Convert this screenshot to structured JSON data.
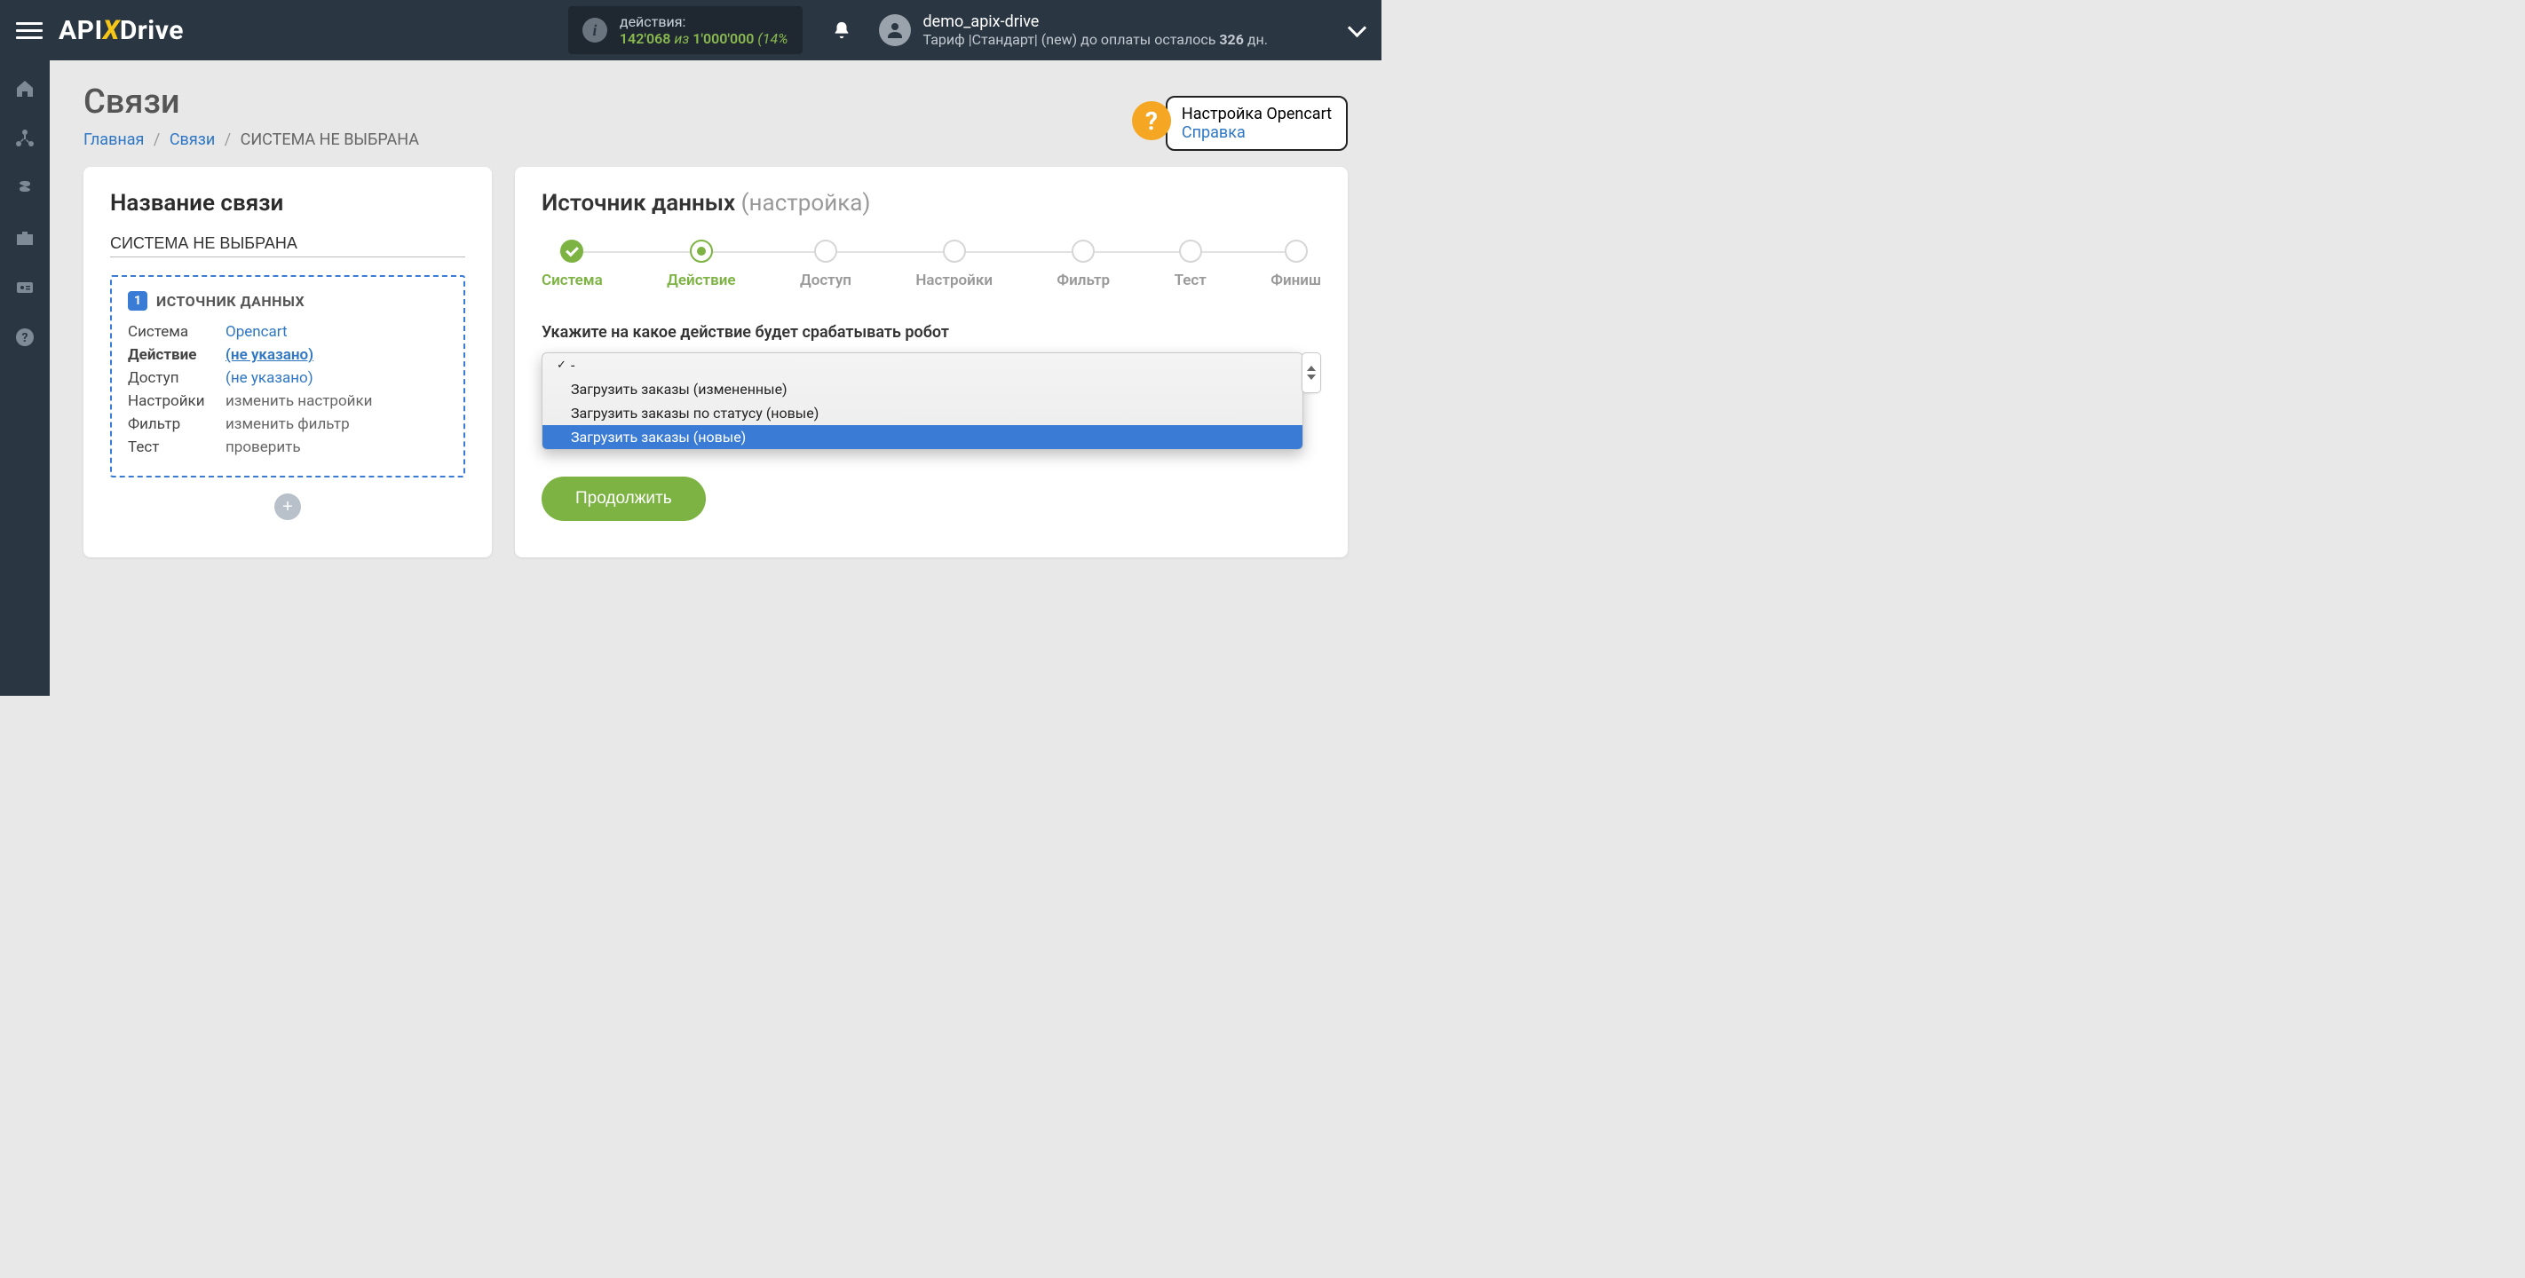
{
  "header": {
    "logo_pre": "API",
    "logo_x": "X",
    "logo_post": "Drive",
    "actions_label": "действия:",
    "actions_count": "142'068",
    "actions_of": "из",
    "actions_total": "1'000'000",
    "actions_percent": "(14%",
    "user_name": "demo_apix-drive",
    "plan_prefix": "Тариф |Стандарт| (new) до оплаты осталось ",
    "plan_days": "326",
    "plan_suffix": " дн."
  },
  "page": {
    "title": "Связи",
    "breadcrumb_home": "Главная",
    "breadcrumb_links": "Связи",
    "breadcrumb_current": "СИСТЕМА НЕ ВЫБРАНА"
  },
  "help": {
    "title": "Настройка Opencart",
    "link": "Справка"
  },
  "left": {
    "card_title": "Название связи",
    "conn_value": "СИСТЕМА НЕ ВЫБРАНА",
    "source_badge": "1",
    "source_header": "ИСТОЧНИК ДАННЫХ",
    "rows": [
      {
        "label": "Система",
        "value": "Opencart",
        "style": "link"
      },
      {
        "label": "Действие",
        "value": "(не указано)",
        "style": "link-u"
      },
      {
        "label": "Доступ",
        "value": "(не указано)",
        "style": "link"
      },
      {
        "label": "Настройки",
        "value": "изменить настройки",
        "style": "gray"
      },
      {
        "label": "Фильтр",
        "value": "изменить фильтр",
        "style": "gray"
      },
      {
        "label": "Тест",
        "value": "проверить",
        "style": "gray"
      }
    ]
  },
  "right": {
    "title": "Источник данных",
    "subtitle": "(настройка)",
    "steps": [
      {
        "label": "Система",
        "state": "done"
      },
      {
        "label": "Действие",
        "state": "active"
      },
      {
        "label": "Доступ",
        "state": ""
      },
      {
        "label": "Настройки",
        "state": ""
      },
      {
        "label": "Фильтр",
        "state": ""
      },
      {
        "label": "Тест",
        "state": ""
      },
      {
        "label": "Финиш",
        "state": ""
      }
    ],
    "form_label": "Укажите на какое действие будет срабатывать робот",
    "dropdown": {
      "selected": "-",
      "options": [
        {
          "text": "-",
          "checked": true,
          "highlight": false
        },
        {
          "text": "Загрузить заказы (измененные)",
          "checked": false,
          "highlight": false
        },
        {
          "text": "Загрузить заказы по статусу (новые)",
          "checked": false,
          "highlight": false
        },
        {
          "text": "Загрузить заказы (новые)",
          "checked": false,
          "highlight": true
        }
      ]
    },
    "continue_label": "Продолжить"
  }
}
